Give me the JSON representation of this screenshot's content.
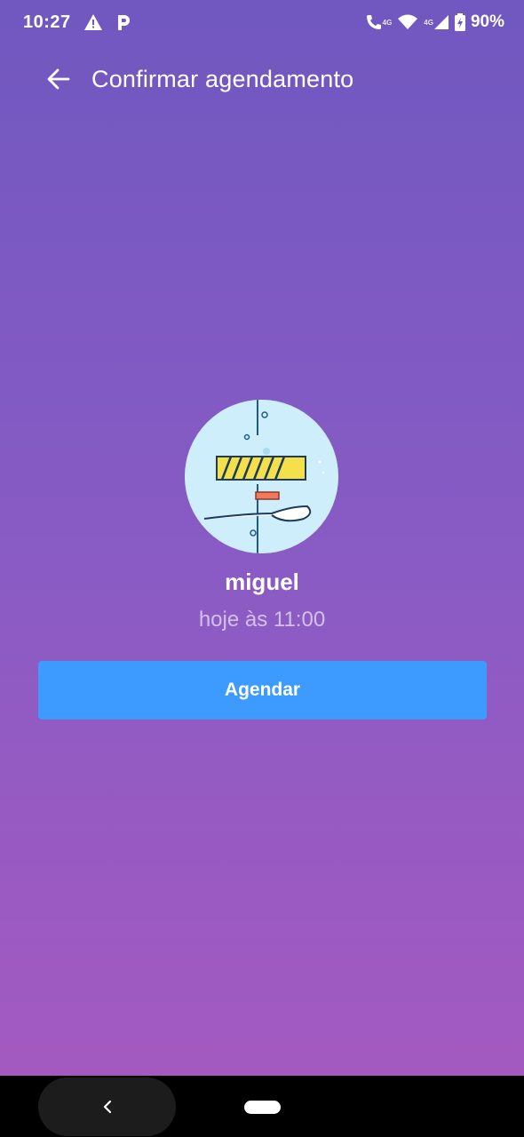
{
  "status_bar": {
    "time": "10:27",
    "battery": "90%",
    "signal_tag_1": "4G",
    "signal_tag_2": "4G",
    "icons": [
      "warning-icon",
      "parking-icon",
      "volte-call-icon",
      "wifi-icon",
      "cell-signal-icon",
      "battery-charging-icon"
    ]
  },
  "app_bar": {
    "title": "Confirmar agendamento",
    "back_icon": "arrow-left-icon"
  },
  "profile": {
    "name": "miguel",
    "avatar_icon": "illustration-avatar"
  },
  "appointment": {
    "time_text": "hoje às 11:00"
  },
  "actions": {
    "confirm_label": "Agendar"
  },
  "colors": {
    "gradient_top": "#7058c0",
    "gradient_bottom": "#a65ac0",
    "button": "#3d9bff"
  },
  "nav_bar": {
    "back_icon": "chevron-left-icon",
    "home_icon": "home-pill-icon"
  }
}
